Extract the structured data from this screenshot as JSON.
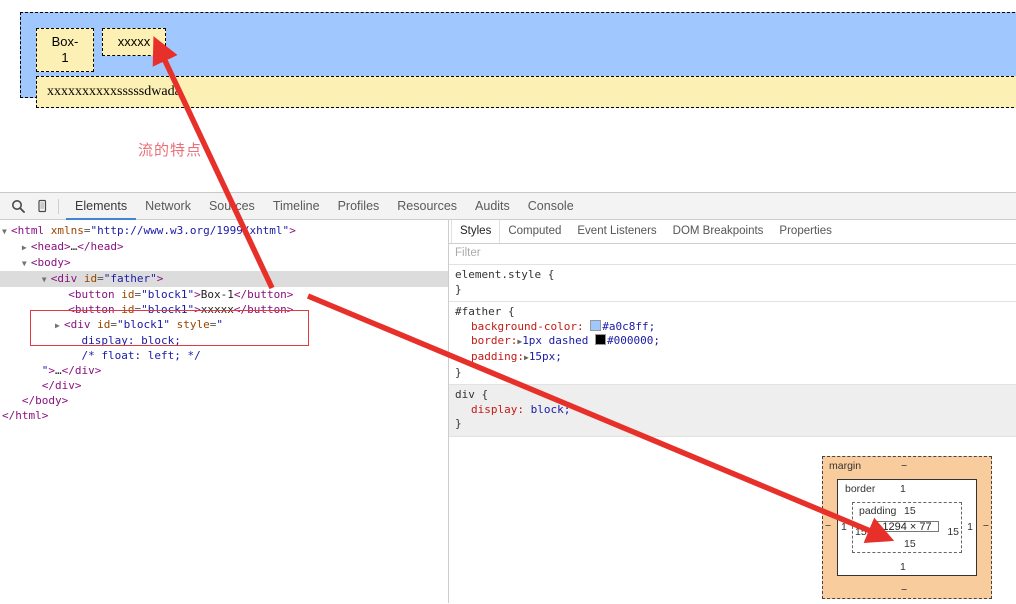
{
  "page_render": {
    "father_div": {
      "button1_label": "Box-1",
      "button2_label": "xxxxx",
      "block_div_text": "xxxxxxxxxxsssssdwada"
    },
    "annotation": "流的特点",
    "colors": {
      "father_bg": "#a0c8ff",
      "child_bg": "#fdf0b4",
      "annotation": "#e8707a",
      "arrow": "#e8302a"
    }
  },
  "devtools": {
    "toolbar": {
      "search_icon": "search-icon",
      "device_icon": "device-toolbar-icon",
      "tabs": [
        {
          "label": "Elements",
          "active": true
        },
        {
          "label": "Network",
          "active": false
        },
        {
          "label": "Sources",
          "active": false
        },
        {
          "label": "Timeline",
          "active": false
        },
        {
          "label": "Profiles",
          "active": false
        },
        {
          "label": "Resources",
          "active": false
        },
        {
          "label": "Audits",
          "active": false
        },
        {
          "label": "Console",
          "active": false
        }
      ],
      "active_tab_underline": "#4285d4"
    },
    "dom_tree": {
      "lines": [
        "<html xmlns=\"http://www.w3.org/1999/xhtml\">",
        "<head>…</head>",
        "<body>",
        "<div id=\"father\">",
        "<button id=\"block1\">Box-1</button>",
        "<button id=\"block1\">xxxxx</button>",
        "<div id=\"block1\" style=\"",
        "display: block;",
        "/* float: left; */",
        "\">…</div>",
        "</div>",
        "</body>",
        "</html>"
      ],
      "selected_line": "<div id=\"father\">",
      "highlight_box_note": "red annotation rectangle around the two button lines"
    },
    "styles_pane": {
      "tabs": [
        {
          "label": "Styles",
          "active": true
        },
        {
          "label": "Computed",
          "active": false
        },
        {
          "label": "Event Listeners",
          "active": false
        },
        {
          "label": "DOM Breakpoints",
          "active": false
        },
        {
          "label": "Properties",
          "active": false
        }
      ],
      "filter_placeholder": "Filter",
      "rules": [
        {
          "selector": "element.style {",
          "close": "}",
          "declarations": []
        },
        {
          "selector": "#father {",
          "close": "}",
          "declarations": [
            {
              "property": "background-color:",
              "value": "#a0c8ff;",
              "swatch": "#a0c8ff",
              "expandable": false
            },
            {
              "property": "border:",
              "value": "1px dashed",
              "value2": "#000000;",
              "swatch": "#000000",
              "expandable": true
            },
            {
              "property": "padding:",
              "value": "15px;",
              "expandable": true
            }
          ]
        },
        {
          "selector": "div {",
          "close": "}",
          "user_agent": true,
          "declarations": [
            {
              "property": "display:",
              "value": "block;",
              "expandable": false
            }
          ]
        }
      ]
    },
    "box_model": {
      "margin_label": "margin",
      "margin_top": "−",
      "margin_right": "−",
      "margin_bottom": "−",
      "margin_left": "−",
      "border_label": "border",
      "border_top": "1",
      "border_right": "1",
      "border_bottom": "1",
      "border_left": "1",
      "padding_label": "padding",
      "padding_top": "15",
      "padding_right": "15",
      "padding_bottom": "15",
      "padding_left": "15",
      "content_size": "1294 × 77",
      "colors": {
        "margin_fill": "#f9cc9d",
        "border_fill": "#ffffff"
      }
    }
  }
}
